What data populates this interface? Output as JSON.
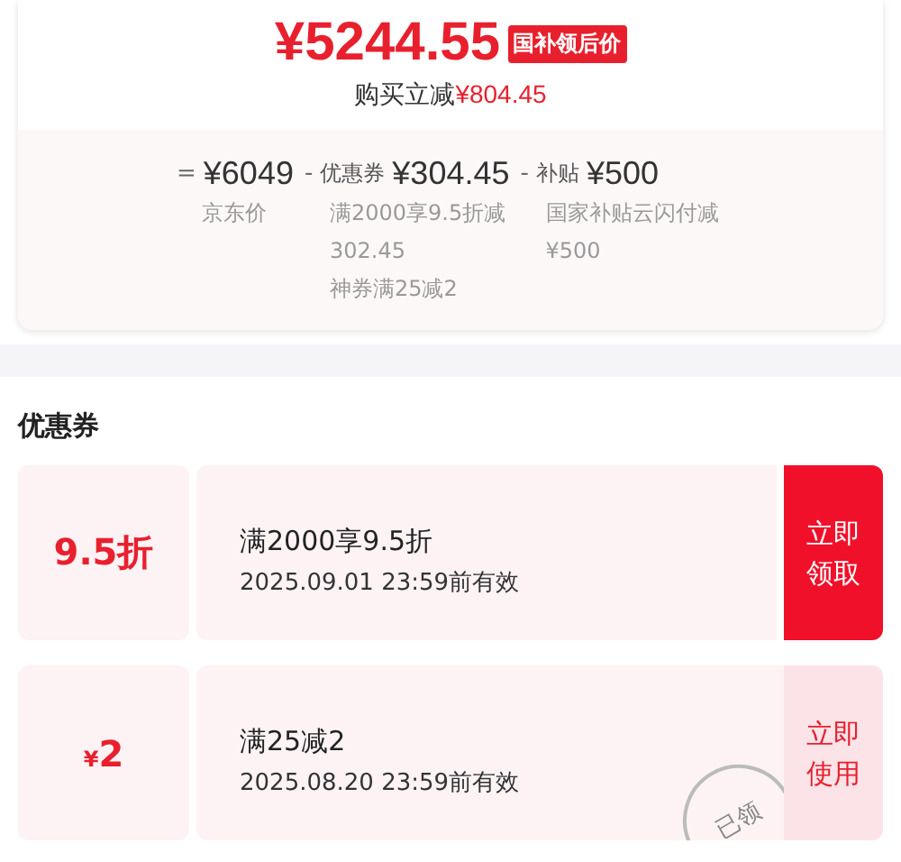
{
  "price": {
    "amount": "¥5244.55",
    "tag": "国补领后价",
    "discount_label": "购买立减",
    "discount_amount": "¥804.45"
  },
  "breakdown": [
    {
      "operator": "=",
      "amount": "¥6049",
      "notes": [
        "京东价"
      ]
    },
    {
      "operator": "-",
      "label": "优惠券",
      "amount": "¥304.45",
      "notes": [
        "满2000享9.5折减",
        "302.45",
        "神券满25减2"
      ]
    },
    {
      "operator": "-",
      "label": "补贴",
      "amount": "¥500",
      "notes": [
        "国家补贴云闪付减",
        "¥500"
      ]
    }
  ],
  "coupons_section": {
    "title": "优惠券",
    "coupons": [
      {
        "kind": "discount",
        "value": "9.5折",
        "title": "满2000享9.5折",
        "validity": "2025.09.01 23:59前有效",
        "button": "立即领取",
        "claimed": false
      },
      {
        "kind": "cash",
        "currency": "¥",
        "value": "2",
        "title": "满25减2",
        "validity": "2025.08.20 23:59前有效",
        "button": "立即使用",
        "claimed": true,
        "stamp": "已领"
      }
    ]
  }
}
